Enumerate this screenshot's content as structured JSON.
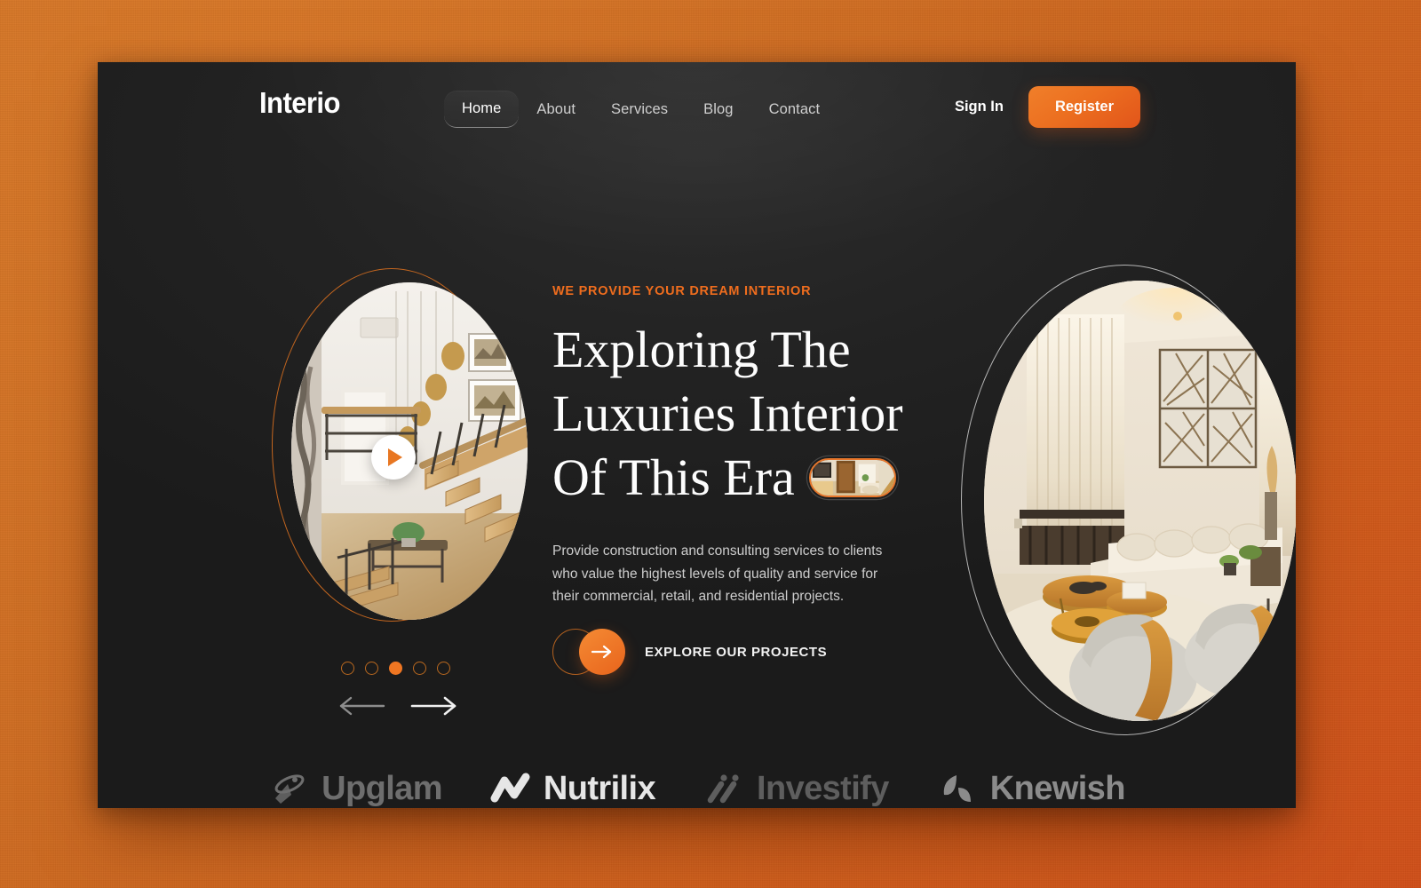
{
  "theme": {
    "accent": "#ef7622",
    "accent_dark": "#e2551a",
    "card_bg": "#1f1f1f",
    "page_bg": "#cf6c22",
    "text_light": "#ffffff",
    "text_muted": "#cdcdcd"
  },
  "nav": {
    "logo": "Interio",
    "items": [
      {
        "label": "Home",
        "active": true
      },
      {
        "label": "About",
        "active": false
      },
      {
        "label": "Services",
        "active": false
      },
      {
        "label": "Blog",
        "active": false
      },
      {
        "label": "Contact",
        "active": false
      }
    ],
    "sign_in_label": "Sign In",
    "register_label": "Register"
  },
  "hero": {
    "eyebrow": "WE PROVIDE YOUR DREAM INTERIOR",
    "headline_line1": "Exploring The",
    "headline_line2": "Luxuries Interior",
    "headline_line3": "Of This Era",
    "paragraph": "Provide construction and consulting services to clients who value the highest levels of quality and service for their commercial, retail, and residential projects.",
    "cta_label": "EXPLORE OUR PROJECTS",
    "media": {
      "left_image_alt": "modern staircase interior with pendant lights",
      "right_image_alt": "luxury living room with sectional sofa and wall art",
      "pill_image_alt": "kitchen and dining interior thumbnail",
      "play_icon": "play-icon"
    }
  },
  "carousel": {
    "total_slides": 5,
    "active_slide": 3,
    "prev_label": "Previous slide",
    "next_label": "Next slide"
  },
  "brands": [
    {
      "name": "Upglam",
      "mark": "saturn-icon"
    },
    {
      "name": "Nutrilix",
      "mark": "zigzag-icon"
    },
    {
      "name": "Investify",
      "mark": "slashes-icon"
    },
    {
      "name": "Knewish",
      "mark": "leaf-icon"
    }
  ]
}
